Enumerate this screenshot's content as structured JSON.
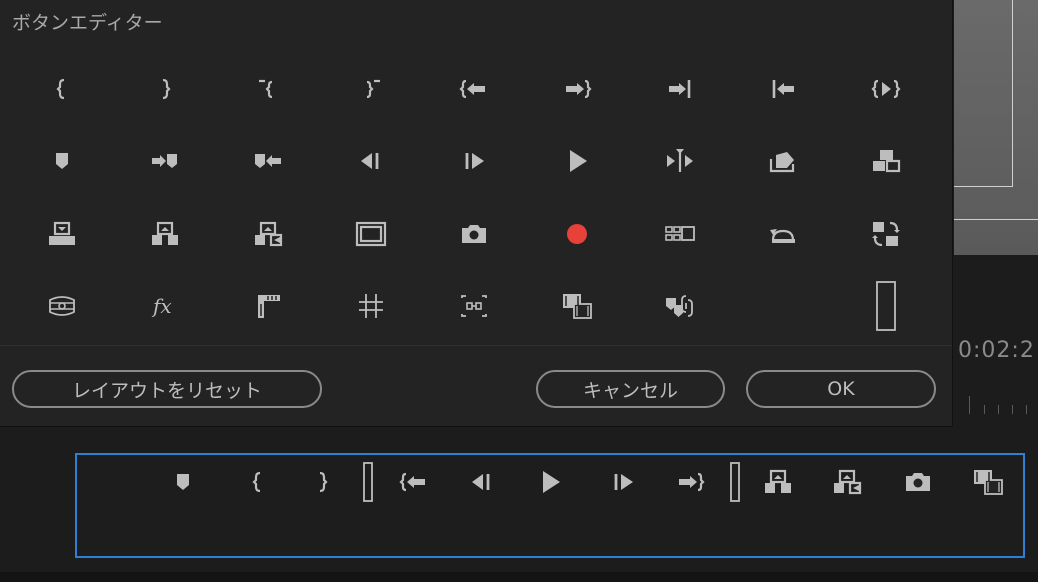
{
  "dialog": {
    "title": "ボタンエディター",
    "buttons": {
      "reset": "レイアウトをリセット",
      "cancel": "キャンセル",
      "ok": "OK"
    }
  },
  "grid_icons": [
    [
      "mark-in-icon",
      "mark-out-icon",
      "clear-in-icon",
      "clear-out-icon",
      "go-to-in-icon",
      "go-to-out-icon",
      "go-to-next-edit-icon",
      "go-to-prev-edit-icon",
      "play-in-to-out-icon"
    ],
    [
      "add-marker-icon",
      "go-to-next-marker-icon",
      "go-to-prev-marker-icon",
      "step-back-icon",
      "step-forward-icon",
      "play-icon",
      "trim-icon",
      "export-frame-icon",
      "insert-icon"
    ],
    [
      "overwrite-icon",
      "lift-icon",
      "extract-icon",
      "safe-margins-icon",
      "camera-icon",
      "record-icon",
      "multi-camera-icon",
      "loop-icon",
      "toggle-proxy-icon"
    ],
    [
      "vr-video-icon",
      "fx-icon",
      "comparison-icon",
      "grid-icon",
      "multi-camera-view-icon",
      "toggle-frame-icon",
      "linked-marker-icon",
      "",
      "spacer-icon"
    ]
  ],
  "strip_icons": [
    "add-marker-icon",
    "mark-in-icon",
    "mark-out-icon",
    "spacer-icon",
    "go-to-in-icon",
    "step-back-icon",
    "play-icon",
    "step-forward-icon",
    "go-to-out-icon",
    "spacer-icon",
    "lift-icon",
    "extract-icon",
    "camera-icon",
    "toggle-frame-icon"
  ],
  "background": {
    "timecode": "0:02:2"
  },
  "colors": {
    "record": "#e8413a",
    "strip_border": "#2f7fd6",
    "icon": "#bdbdbd"
  }
}
